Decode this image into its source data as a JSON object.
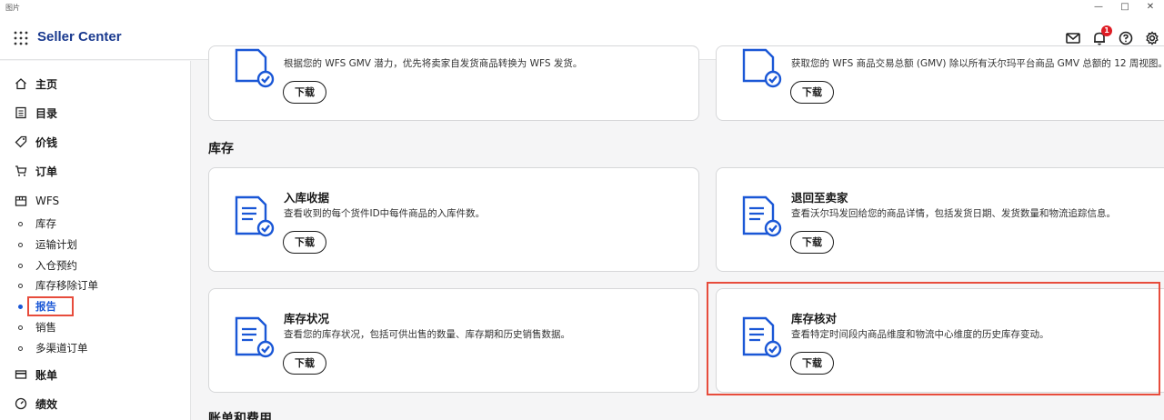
{
  "window": {
    "title": "图片",
    "minimize": "—",
    "maximize": "□",
    "close": "✕"
  },
  "appbar": {
    "brand": "Seller Center",
    "notification_count": "1",
    "icons": [
      "app-grid-icon",
      "mail-icon",
      "bell-icon",
      "help-icon",
      "gear-icon"
    ]
  },
  "sidebar": {
    "items": [
      {
        "label": "主页",
        "icon": "home-icon"
      },
      {
        "label": "目录",
        "icon": "catalog-icon"
      },
      {
        "label": "价钱",
        "icon": "tag-icon"
      },
      {
        "label": "订单",
        "icon": "cart-icon"
      },
      {
        "label": "WFS",
        "icon": "box-icon"
      },
      {
        "label": "账单",
        "icon": "card-icon"
      },
      {
        "label": "绩效",
        "icon": "gauge-icon"
      }
    ],
    "wfs_sub": [
      "库存",
      "运输计划",
      "入仓预约",
      "库存移除订单",
      "报告",
      "销售",
      "多渠道订单"
    ],
    "active": "报告"
  },
  "main": {
    "top_cards": [
      {
        "desc": "根据您的 WFS GMV 潜力，优先将卖家自发货商品转换为 WFS 发货。",
        "button": "下载"
      },
      {
        "desc": "获取您的 WFS 商品交易总额 (GMV) 除以所有沃尔玛平台商品 GMV 总额的 12 周视图。",
        "button": "下载"
      }
    ],
    "section_inventory": "库存",
    "inventory_cards": [
      {
        "title": "入库收据",
        "desc": "查看收到的每个货件ID中每件商品的入库件数。",
        "button": "下载"
      },
      {
        "title": "退回至卖家",
        "desc": "查看沃尔玛发回给您的商品详情，包括发货日期、发货数量和物流追踪信息。",
        "button": "下载"
      },
      {
        "title": "库存状况",
        "desc": "查看您的库存状况，包括可供出售的数量、库存期和历史销售数据。",
        "button": "下载"
      },
      {
        "title": "库存核对",
        "desc": "查看特定时间段内商品维度和物流中心维度的历史库存变动。",
        "button": "下载"
      }
    ],
    "section_billing": "账单和费用"
  },
  "colors": {
    "brand": "#1a3a8f",
    "accent": "#1a57d6",
    "highlight": "#e74c3c",
    "badge": "#de1c24"
  }
}
